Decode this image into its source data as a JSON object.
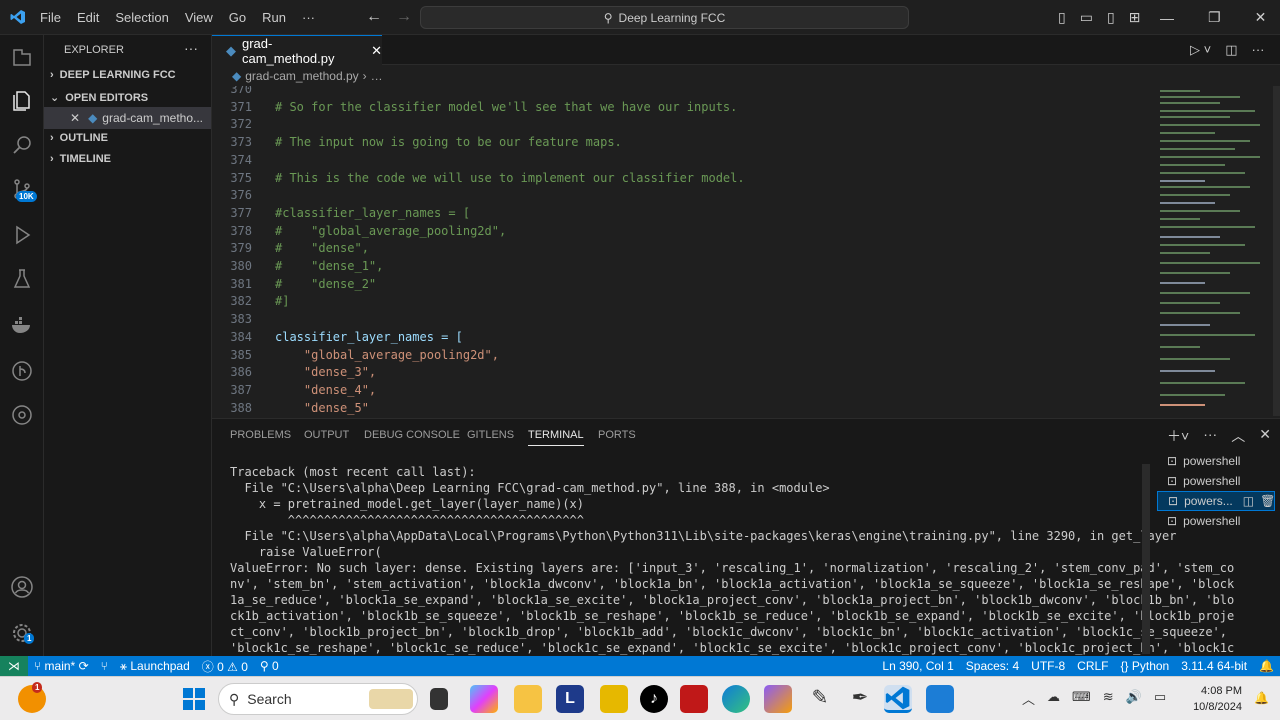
{
  "titlebar": {
    "menu": [
      "File",
      "Edit",
      "Selection",
      "View",
      "Go",
      "Run",
      "···"
    ],
    "command_center": "Deep Learning FCC"
  },
  "activity": {
    "badge_source_control": "10K",
    "badge_settings": "1"
  },
  "sidebar": {
    "header": "EXPLORER",
    "sections": [
      "DEEP LEARNING FCC",
      "OPEN EDITORS",
      "OUTLINE",
      "TIMELINE"
    ],
    "open_file": "grad-cam_metho..."
  },
  "editor": {
    "tab_label": "grad-cam_method.py",
    "breadcrumb_file": "grad-cam_method.py",
    "breadcrumb_more": "…",
    "lines": [
      {
        "n": "370",
        "t": ""
      },
      {
        "n": "371",
        "t": "# So for the classifier model we'll see that we have our inputs.",
        "k": "cm"
      },
      {
        "n": "372",
        "t": ""
      },
      {
        "n": "373",
        "t": "# The input now is going to be our feature maps.",
        "k": "cm"
      },
      {
        "n": "374",
        "t": ""
      },
      {
        "n": "375",
        "t": "# This is the code we will use to implement our classifier model.",
        "k": "cm"
      },
      {
        "n": "376",
        "t": ""
      },
      {
        "n": "377",
        "t": "#classifier_layer_names = [",
        "k": "cm"
      },
      {
        "n": "378",
        "t": "#    \"global_average_pooling2d\",",
        "k": "cm"
      },
      {
        "n": "379",
        "t": "#    \"dense\",",
        "k": "cm"
      },
      {
        "n": "380",
        "t": "#    \"dense_1\",",
        "k": "cm"
      },
      {
        "n": "381",
        "t": "#    \"dense_2\"",
        "k": "cm"
      },
      {
        "n": "382",
        "t": "#]",
        "k": "cm"
      },
      {
        "n": "383",
        "t": ""
      },
      {
        "n": "384",
        "t": "classifier_layer_names = [",
        "k": "vr"
      },
      {
        "n": "385",
        "t": "    \"global_average_pooling2d\",",
        "k": "st"
      },
      {
        "n": "386",
        "t": "    \"dense_3\",",
        "k": "st"
      },
      {
        "n": "387",
        "t": "    \"dense_4\",",
        "k": "st"
      },
      {
        "n": "388",
        "t": "    \"dense_5\"",
        "k": "st"
      }
    ]
  },
  "panel": {
    "tabs": [
      "PROBLEMS",
      "OUTPUT",
      "DEBUG CONSOLE",
      "GITLENS",
      "TERMINAL",
      "PORTS"
    ],
    "active_tab": "TERMINAL",
    "terminal_lines": [
      "Traceback (most recent call last):",
      "  File \"C:\\Users\\alpha\\Deep Learning FCC\\grad-cam_method.py\", line 388, in <module>",
      "    x = pretrained_model.get_layer(layer_name)(x)",
      "        ^^^^^^^^^^^^^^^^^^^^^^^^^^^^^^^^^^^^^^^^^",
      "  File \"C:\\Users\\alpha\\AppData\\Local\\Programs\\Python\\Python311\\Lib\\site-packages\\keras\\engine\\training.py\", line 3290, in get_layer",
      "    raise ValueError(",
      "ValueError: No such layer: dense. Existing layers are: ['input_3', 'rescaling_1', 'normalization', 'rescaling_2', 'stem_conv_pad', 'stem_co",
      "nv', 'stem_bn', 'stem_activation', 'block1a_dwconv', 'block1a_bn', 'block1a_activation', 'block1a_se_squeeze', 'block1a_se_reshape', 'block",
      "1a_se_reduce', 'block1a_se_expand', 'block1a_se_excite', 'block1a_project_conv', 'block1a_project_bn', 'block1b_dwconv', 'block1b_bn', 'blo",
      "ck1b_activation', 'block1b_se_squeeze', 'block1b_se_reshape', 'block1b_se_reduce', 'block1b_se_expand', 'block1b_se_excite', 'block1b_proje",
      "ct_conv', 'block1b_project_bn', 'block1b_drop', 'block1b_add', 'block1c_dwconv', 'block1c_bn', 'block1c_activation', 'block1c_se_squeeze',",
      "'block1c_se_reshape', 'block1c_se_reduce', 'block1c_se_expand', 'block1c_se_excite', 'block1c_project_conv', 'block1c_project_bn', 'block1c"
    ],
    "terminals": [
      "powershell",
      "powershell",
      "powers...",
      "powershell"
    ]
  },
  "status": {
    "branch": "main*",
    "launchpad": "Launchpad",
    "problems": "0 ⚠ 0",
    "ports": "0",
    "position": "Ln 390, Col 1",
    "spaces": "Spaces: 4",
    "encoding": "UTF-8",
    "eol": "CRLF",
    "language": "Python",
    "interpreter": "3.11.4 64-bit"
  },
  "taskbar": {
    "search_placeholder": "Search",
    "time": "4:08 PM",
    "date": "10/8/2024",
    "notif_badge": "1"
  }
}
